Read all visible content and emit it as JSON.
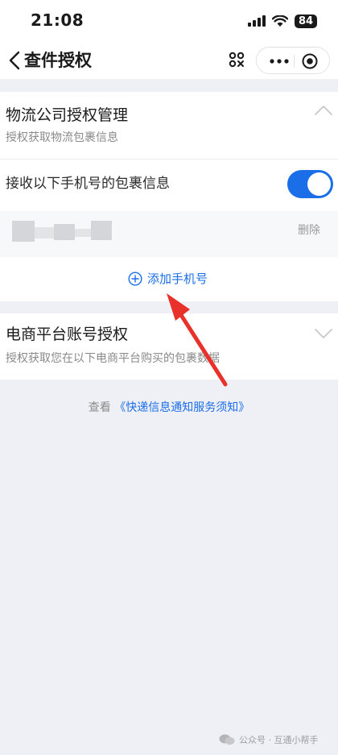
{
  "status_bar": {
    "time": "21:08",
    "battery": "84"
  },
  "nav": {
    "title": "查件授权"
  },
  "logistics": {
    "title": "物流公司授权管理",
    "subtitle": "授权获取物流包裹信息",
    "receive_label": "接收以下手机号的包裹信息",
    "toggle_on": true,
    "delete_label": "删除",
    "add_phone_label": "添加手机号"
  },
  "ecommerce": {
    "title": "电商平台账号授权",
    "subtitle": "授权获取您在以下电商平台购买的包裹数据"
  },
  "notice": {
    "prefix": "查看",
    "link": "《快递信息通知服务须知》"
  },
  "watermark": {
    "text": "公众号 · 互通小帮手"
  },
  "colors": {
    "accent": "#1a6ee8",
    "annotation_arrow": "#e8312a"
  }
}
